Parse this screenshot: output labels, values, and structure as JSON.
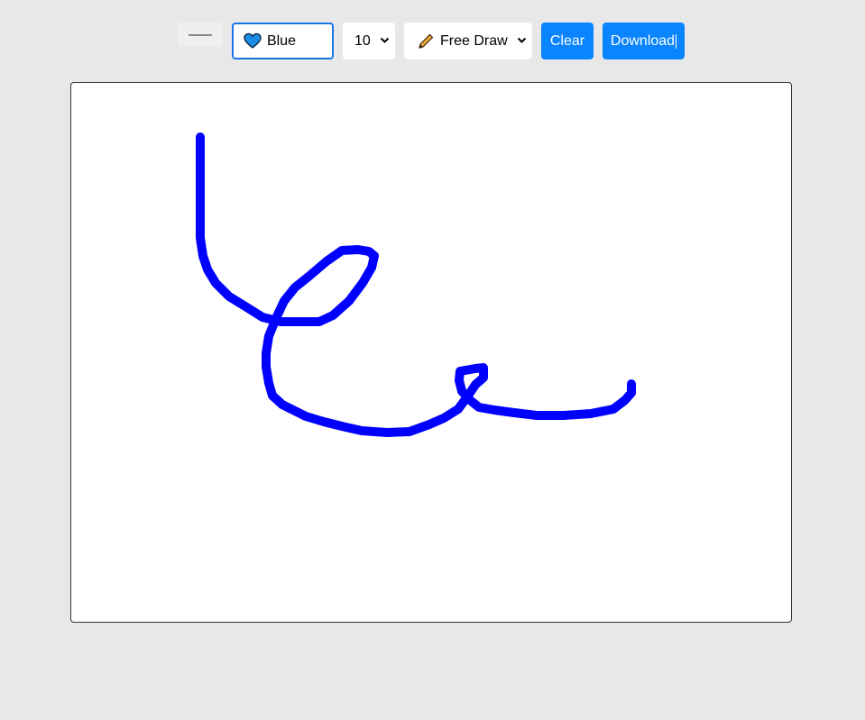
{
  "toolbar": {
    "color_select": {
      "value": "Blue",
      "icon": "blue-heart-icon"
    },
    "size_select": {
      "value": "10"
    },
    "mode_select": {
      "value": "Free Draw",
      "icon": "pencil-icon"
    },
    "clear_label": "Clear",
    "download_label": "Download"
  },
  "canvas": {
    "stroke_color": "#0000ff",
    "stroke_width": 10
  },
  "colors": {
    "accent": "#0a84ff",
    "background": "#e8e8e8"
  }
}
